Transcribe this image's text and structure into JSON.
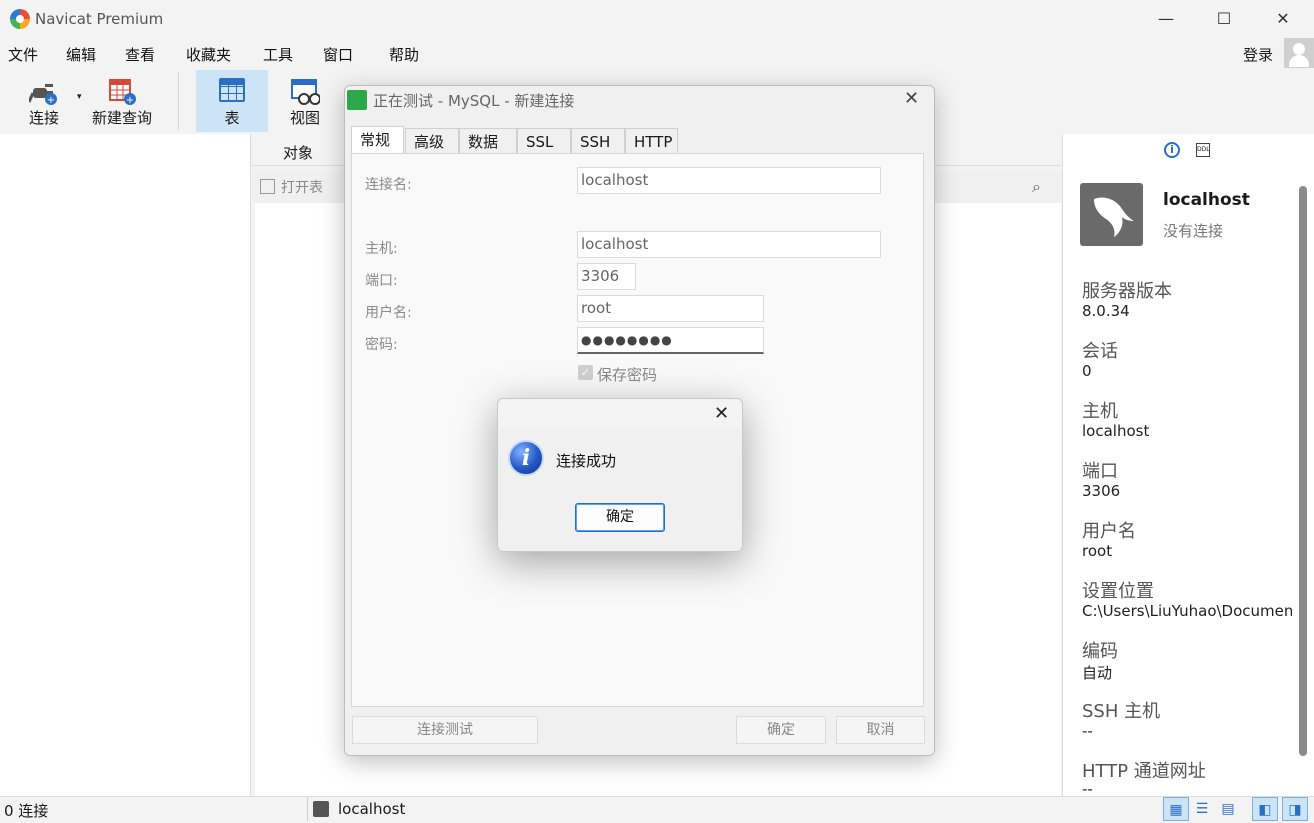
{
  "app": {
    "title": "Navicat Premium"
  },
  "window_controls": {
    "minimize": "—",
    "maximize": "☐",
    "close": "✕"
  },
  "menu": [
    "文件",
    "编辑",
    "查看",
    "收藏夹",
    "工具",
    "窗口",
    "帮助"
  ],
  "login_label": "登录",
  "toolbar": {
    "connect": "连接",
    "new_query": "新建查询",
    "table": "表",
    "view": "视图"
  },
  "object_tab": "对象",
  "object_toolbar": {
    "open_table": "打开表"
  },
  "info_pane": {
    "connection_name": "localhost",
    "connection_status": "没有连接",
    "fields": [
      {
        "label": "服务器版本",
        "value": "8.0.34"
      },
      {
        "label": "会话",
        "value": "0"
      },
      {
        "label": "主机",
        "value": "localhost"
      },
      {
        "label": "端口",
        "value": "3306"
      },
      {
        "label": "用户名",
        "value": "root"
      },
      {
        "label": "设置位置",
        "value": "C:\\Users\\LiuYuhao\\Documen"
      },
      {
        "label": "编码",
        "value": "自动"
      },
      {
        "label": "SSH 主机",
        "value": "--"
      },
      {
        "label": "HTTP 通道网址",
        "value": "--"
      }
    ]
  },
  "status_bar": {
    "connections": "0 连接",
    "current_connection": "localhost"
  },
  "dialog": {
    "title": "正在测试 - MySQL - 新建连接",
    "tabs": [
      "常规",
      "高级",
      "数据库",
      "SSL",
      "SSH",
      "HTTP"
    ],
    "form": {
      "conn_name_label": "连接名:",
      "conn_name": "localhost",
      "host_label": "主机:",
      "host": "localhost",
      "port_label": "端口:",
      "port": "3306",
      "user_label": "用户名:",
      "user": "root",
      "password_label": "密码:",
      "password": "●●●●●●●●",
      "save_password": "保存密码"
    },
    "buttons": {
      "test": "连接测试",
      "ok": "确定",
      "cancel": "取消"
    }
  },
  "message_box": {
    "text": "连接成功",
    "ok": "确定"
  }
}
